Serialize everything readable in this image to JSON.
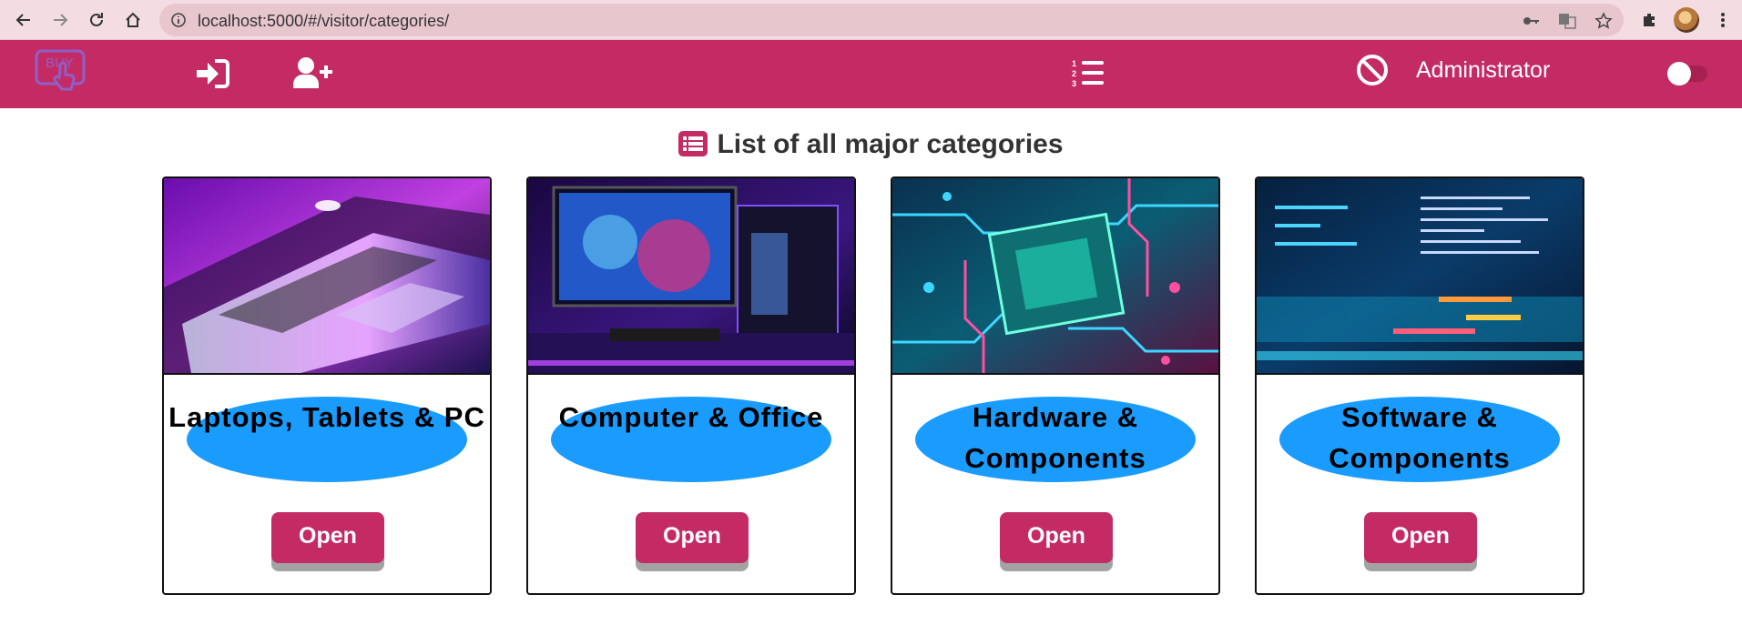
{
  "browser": {
    "url": "localhost:5000/#/visitor/categories/",
    "icons": [
      "back-icon",
      "forward-icon",
      "reload-icon",
      "home-icon",
      "info-icon",
      "key-icon",
      "translate-icon",
      "star-icon",
      "extensions-icon",
      "profile-avatar",
      "menu-icon"
    ]
  },
  "header": {
    "logo_text": "BUY",
    "icons": [
      "sign-in-icon",
      "user-plus-icon",
      "ordered-list-icon",
      "ban-icon"
    ],
    "user_label": "Administrator"
  },
  "main": {
    "title": "List of all major categories",
    "title_icon": "list-alt-icon",
    "categories": [
      {
        "name": "Laptops, Tablets & PC",
        "button": "Open"
      },
      {
        "name": "Computer & Office",
        "button": "Open"
      },
      {
        "name": "Hardware & Components",
        "button": "Open"
      },
      {
        "name": "Software & Components",
        "button": "Open"
      }
    ]
  },
  "colors": {
    "brand": "#c42b64",
    "chrome": "#f3dde2",
    "ellipse": "#1a9cff",
    "button_shadow": "#a3a3a3"
  }
}
